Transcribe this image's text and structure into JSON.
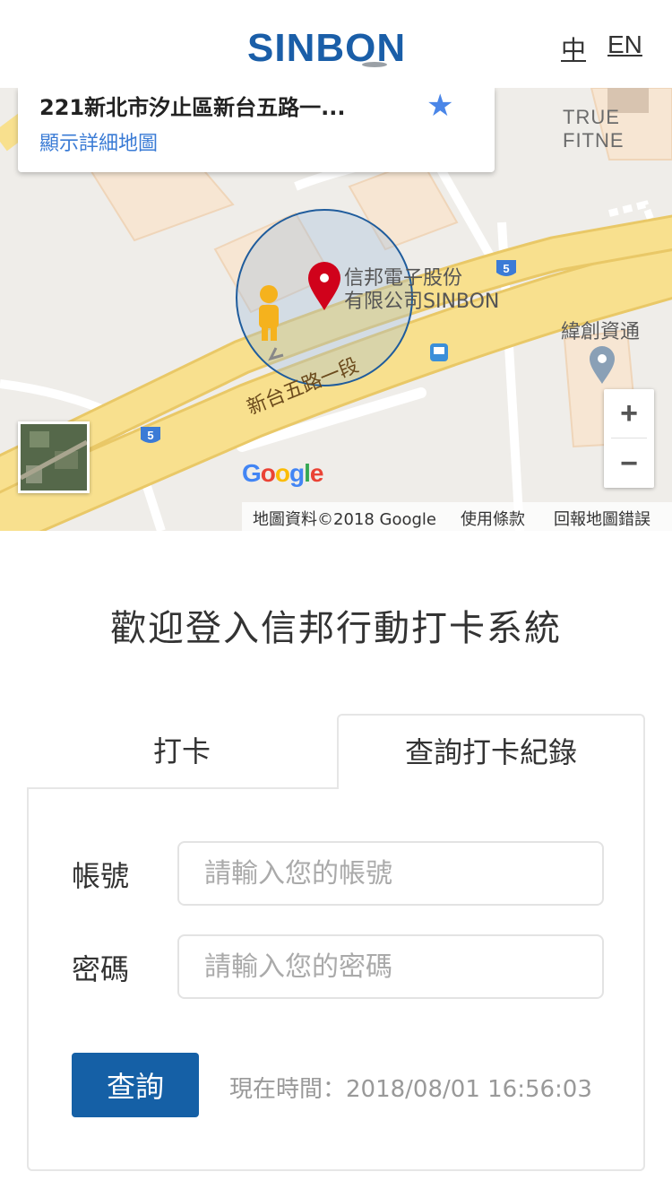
{
  "header": {
    "logo_text": "SINBON",
    "lang_zh": "中",
    "lang_en": "EN"
  },
  "map": {
    "info_card": {
      "address": "221新北市汐止區新台五路一...",
      "link": "顯示詳細地圖",
      "save_icon": "star-icon"
    },
    "places": {
      "main": "信邦電子股份\n有限公司SINBON",
      "main_line1": "信邦電子股份",
      "main_line2": "有限公司SINBON",
      "wei": "緯創資通",
      "fitness": "TRUE FITNE"
    },
    "road_name": "新台五路一段",
    "route_shield": "5",
    "zoom_in": "+",
    "zoom_out": "−",
    "google_logo": "Google",
    "attribution": {
      "data": "地圖資料©2018 Google",
      "terms": "使用條款",
      "report": "回報地圖錯誤"
    },
    "colors": {
      "road": "#f8e08e",
      "road_edge": "#e9c867",
      "pin": "#d0021b",
      "radius": "#1f5c9c"
    }
  },
  "main": {
    "welcome": "歡迎登入信邦行動打卡系統",
    "tabs": [
      {
        "label": "打卡",
        "active": false
      },
      {
        "label": "查詢打卡紀錄",
        "active": true
      }
    ],
    "form": {
      "account_label": "帳號",
      "account_placeholder": "請輸入您的帳號",
      "password_label": "密碼",
      "password_placeholder": "請輸入您的密碼",
      "submit_label": "查詢",
      "clock_text": "現在時間：2018/08/01 16:56:03"
    },
    "colors": {
      "primary_button": "#1560a6"
    }
  }
}
